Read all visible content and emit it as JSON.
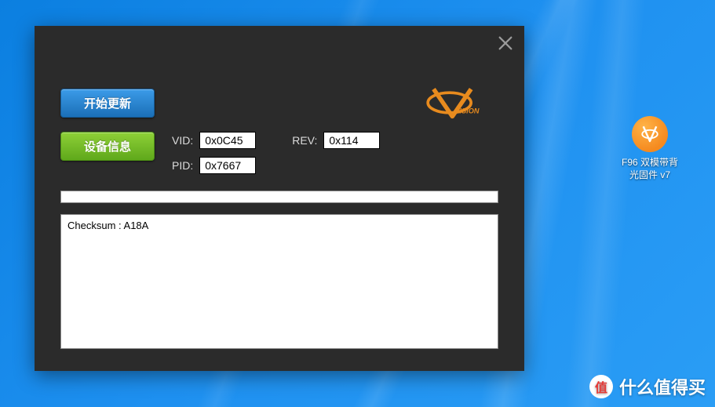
{
  "app": {
    "start_update_label": "开始更新",
    "device_info_label": "设备信息",
    "logo_name": "vision-logo",
    "fields": {
      "vid_label": "VID:",
      "vid_value": "0x0C45",
      "rev_label": "REV:",
      "rev_value": "0x114",
      "pid_label": "PID:",
      "pid_value": "0x7667"
    },
    "log_text": "Checksum : A18A"
  },
  "desktop": {
    "icon_caption": "F96 双模带背\n光固件 v7"
  },
  "watermark": {
    "badge_char": "值",
    "text": "什么值得买"
  }
}
